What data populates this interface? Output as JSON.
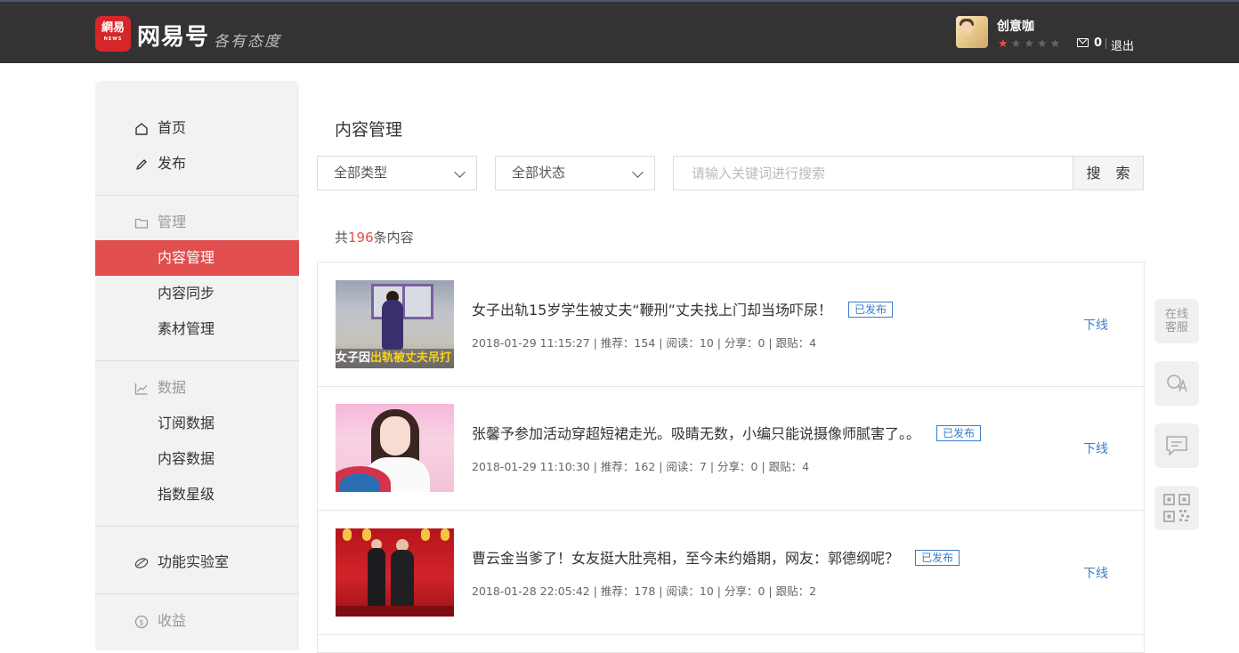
{
  "header": {
    "logo_mark": "網易",
    "logo_mark_sub": "NEWS",
    "logo_text": "网易号",
    "slogan": "各有态度",
    "username": "创意咖",
    "rating_stars": 1,
    "rating_max": 5,
    "message_count": "0",
    "logout_label": "退出"
  },
  "sidebar": {
    "items": [
      {
        "label": "首页",
        "icon": "home-icon"
      },
      {
        "label": "发布",
        "icon": "pencil-icon"
      },
      {
        "label": "管理",
        "icon": "folder-icon"
      },
      {
        "label": "内容管理"
      },
      {
        "label": "内容同步"
      },
      {
        "label": "素材管理"
      },
      {
        "label": "数据",
        "icon": "chart-icon"
      },
      {
        "label": "订阅数据"
      },
      {
        "label": "内容数据"
      },
      {
        "label": "指数星级"
      },
      {
        "label": "功能实验室",
        "icon": "lab-icon"
      },
      {
        "label": "收益",
        "icon": "dollar-icon"
      }
    ],
    "active_item": "内容管理"
  },
  "main": {
    "title": "内容管理",
    "filters": {
      "type_select": "全部类型",
      "status_select": "全部状态",
      "search_placeholder": "请输入关键词进行搜索",
      "search_button": "搜 索"
    },
    "count": {
      "prefix": "共",
      "number": "196",
      "suffix": "条内容"
    },
    "articles": [
      {
        "title": "女子出轨15岁学生被丈夫“鞭刑”丈夫找上门却当场吓尿！",
        "status": "已发布",
        "meta": "2018-01-29 11:15:27 | 推荐：154 | 阅读：10 | 分享：0 | 跟贴：4",
        "action": "下线",
        "thumb_caption_white": "女子因",
        "thumb_caption_yellow": "出轨被丈夫吊打"
      },
      {
        "title": "张馨予参加活动穿超短裙走光。吸睛无数，小编只能说摄像师腻害了。。",
        "status": "已发布",
        "meta": "2018-01-29 11:10:30 | 推荐：162 | 阅读：7 | 分享：0 | 跟贴：4",
        "action": "下线"
      },
      {
        "title": "曹云金当爹了！女友挺大肚亮相，至今未约婚期，网友：郭德纲呢？",
        "status": "已发布",
        "meta": "2018-01-28 22:05:42 | 推荐：178 | 阅读：10 | 分享：0 | 跟贴：2",
        "action": "下线"
      }
    ]
  },
  "float_tools": {
    "service_label": "在线客服",
    "items": [
      "qa-icon",
      "feedback-chat-icon",
      "qrcode-icon"
    ]
  },
  "colors": {
    "header_bg": "#333333",
    "accent_red": "#e04e4e",
    "link_blue": "#3b7bc8",
    "sidebar_bg": "#f2f2f2"
  }
}
